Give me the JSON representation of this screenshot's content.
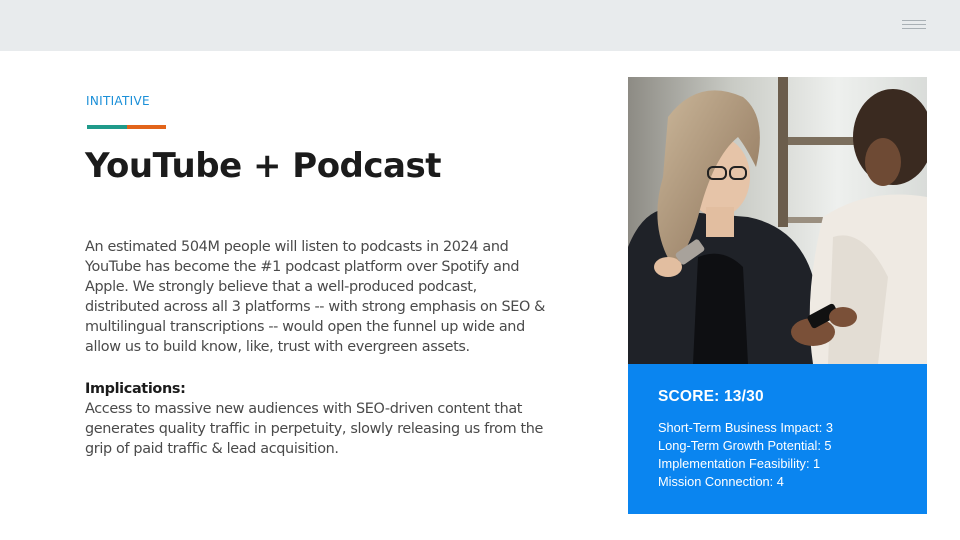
{
  "colors": {
    "top_band": "#e8ebed",
    "eyebrow": "#1a8fd8",
    "accent_teal": "#1f9a8a",
    "accent_orange": "#e2641a",
    "score_panel": "#0a85f0"
  },
  "header": {
    "menu_icon": "hamburger-menu-icon"
  },
  "slide": {
    "eyebrow": "INITIATIVE",
    "title": "YouTube + Podcast",
    "body": "An estimated 504M people will listen to podcasts in 2024 and YouTube has become the #1 podcast platform over Spotify and Apple. We strongly believe that a well-produced podcast, distributed across all 3 platforms -- with strong emphasis on SEO & multilingual transcriptions -- would open the funnel up wide and allow us to build know, like, trust with evergreen assets.",
    "implications_heading": "Implications:",
    "implications_text": "Access to massive new audiences with SEO-driven content that generates quality traffic in perpetuity, slowly releasing us from the grip of paid traffic & lead acquisition."
  },
  "score": {
    "title": "SCORE: 13/30",
    "items": [
      "Short-Term Business Impact: 3",
      "Long-Term Growth Potential: 5",
      "Implementation Feasibility: 1",
      "Mission Connection: 4"
    ]
  }
}
